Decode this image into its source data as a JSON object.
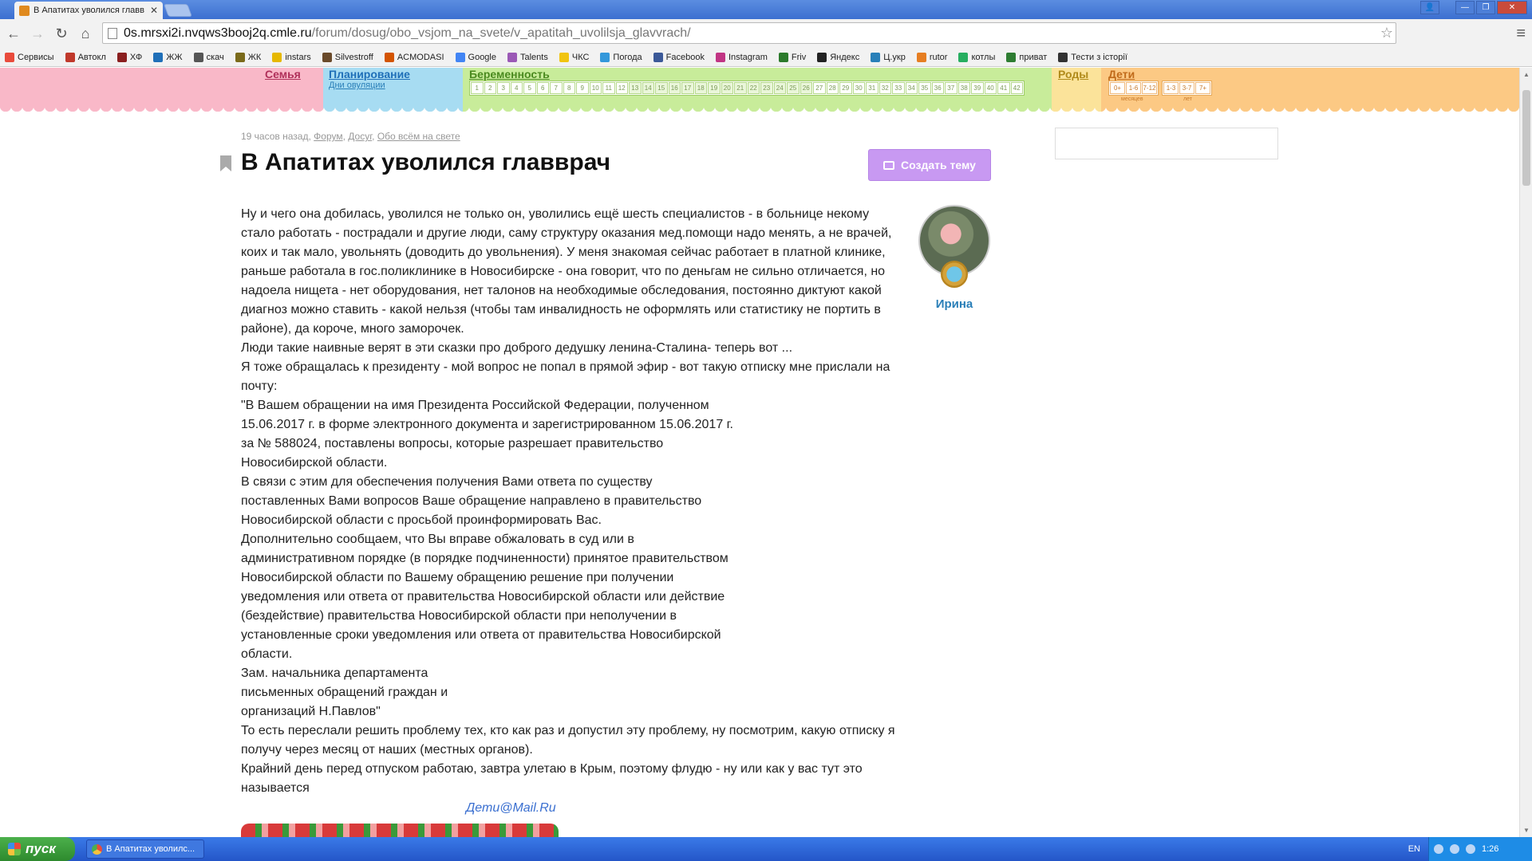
{
  "browser": {
    "tab_title": "В Апатитах уволился главв",
    "url_host": "0s.mrsxi2i.nvqws3booj2q.cmle.ru",
    "url_path": "/forum/dosug/obo_vsjom_na_svete/v_apatitah_uvolilsja_glavvrach/"
  },
  "bookmarks": [
    {
      "label": "Сервисы",
      "color": "#e94b3c"
    },
    {
      "label": "Автокл",
      "color": "#c0392b"
    },
    {
      "label": "ХФ",
      "color": "#8a1f1f"
    },
    {
      "label": "ЖЖ",
      "color": "#1f6fb8"
    },
    {
      "label": "скач",
      "color": "#555555"
    },
    {
      "label": "ЖК",
      "color": "#7a6a1a"
    },
    {
      "label": "instars",
      "color": "#e6b800"
    },
    {
      "label": "Silvestroff",
      "color": "#6a4a2a"
    },
    {
      "label": "ACMODASI",
      "color": "#d35400"
    },
    {
      "label": "Google",
      "color": "#4285f4"
    },
    {
      "label": "Talents",
      "color": "#9b59b6"
    },
    {
      "label": "ЧКС",
      "color": "#f1c40f"
    },
    {
      "label": "Погода",
      "color": "#3498db"
    },
    {
      "label": "Facebook",
      "color": "#3b5998"
    },
    {
      "label": "Instagram",
      "color": "#c13584"
    },
    {
      "label": "Friv",
      "color": "#2c7a2c"
    },
    {
      "label": "Яндекс",
      "color": "#222222"
    },
    {
      "label": "Ц.укр",
      "color": "#2980b9"
    },
    {
      "label": "rutor",
      "color": "#e67e22"
    },
    {
      "label": "котлы",
      "color": "#27ae60"
    },
    {
      "label": "приват",
      "color": "#2e7d32"
    },
    {
      "label": "Тести з історії",
      "color": "#333333"
    }
  ],
  "sitenav": {
    "family": "Семья",
    "planning": "Планирование",
    "ovulation": "Дни овуляции",
    "pregnancy": "Беременность",
    "weeks": [
      "1",
      "2",
      "3",
      "4",
      "5",
      "6",
      "7",
      "8",
      "9",
      "10",
      "11",
      "12",
      "13",
      "14",
      "15",
      "16",
      "17",
      "18",
      "19",
      "20",
      "21",
      "22",
      "23",
      "24",
      "25",
      "26",
      "27",
      "28",
      "29",
      "30",
      "31",
      "32",
      "33",
      "34",
      "35",
      "36",
      "37",
      "38",
      "39",
      "40",
      "41",
      "42"
    ],
    "birth": "Роды",
    "kids": "Дети",
    "ages_months": [
      "0+",
      "1-6",
      "7-12"
    ],
    "ages_years": [
      "1-3",
      "3-7",
      "7+"
    ],
    "months_label": "месяцев",
    "years_label": "лет"
  },
  "article": {
    "time": "19 часов назад,",
    "crumb_forum": "Форум",
    "crumb_dosug": "Досуг",
    "crumb_section": "Обо всём на свете",
    "title": "В Апатитах уволился главврач",
    "create_button": "Создать тему",
    "author": "Ирина",
    "body": [
      "Ну и чего она добилась, уволился не только он, уволились ещё шесть специалистов - в больнице некому стало работать - пострадали и другие люди, саму структуру оказания мед.помощи надо менять, а не врачей, коих и так мало, увольнять (доводить до увольнения). У меня знакомая сейчас работает в платной клинике, раньше работала в гос.поликлинике в Новосибирске - она говорит, что по деньгам не сильно отличается, но надоела нищета - нет оборудования, нет талонов на необходимые обследования, постоянно диктуют какой диагноз можно ставить - какой нельзя (чтобы там инвалидность не оформлять или статистику не портить в районе), да короче, много заморочек.",
      "Люди такие наивные верят в эти сказки про доброго дедушку ленина-Сталина- теперь вот ...",
      "Я тоже обращалась к президенту - мой вопрос не попал в прямой эфир - вот такую отписку мне прислали на почту:",
      "\"В Вашем обращении на имя Президента Российской Федерации, полученном",
      "15.06.2017 г. в форме электронного документа и зарегистрированном 15.06.2017 г.",
      "за № 588024, поставлены вопросы, которые разрешает правительство",
      "Новосибирской области.",
      "В связи с этим для обеспечения получения Вами ответа по существу",
      "поставленных Вами вопросов Ваше обращение направлено в правительство",
      "Новосибирской области с просьбой проинформировать Вас.",
      "Дополнительно сообщаем, что Вы вправе обжаловать в суд или в",
      "административном порядке (в порядке подчиненности) принятое правительством",
      "Новосибирской области по Вашему обращению решение при получении",
      "уведомления или ответа от правительства Новосибирской области или действие",
      "(бездействие) правительства Новосибирской области при неполучении в",
      "установленные сроки уведомления или ответа от правительства Новосибирской",
      "области.",
      "Зам. начальника департамента",
      "письменных обращений граждан и",
      "организаций Н.Павлов\"",
      "То есть переслали решить проблему тех, кто как раз и допустил эту проблему, ну посмотрим, какую отписку я получу через месяц от наших (местных органов).",
      "Крайний день перед отпуском работаю, завтра улетаю в Крым, поэтому флудю - ну или как у вас тут это называется"
    ],
    "banner": "Дети@Mail.Ru"
  },
  "taskbar": {
    "start": "пуск",
    "task_item": "В Апатитах уволилс...",
    "lang": "EN",
    "clock": "1:26"
  }
}
